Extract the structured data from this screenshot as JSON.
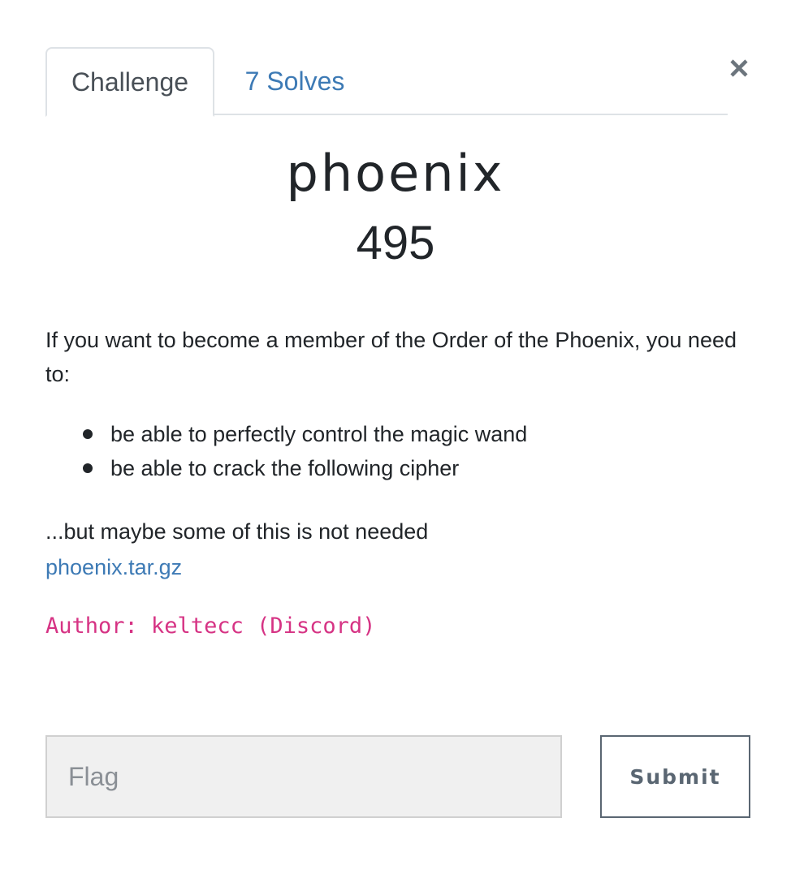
{
  "tabs": [
    {
      "label": "Challenge",
      "active": true
    },
    {
      "label": "7 Solves",
      "active": false
    }
  ],
  "close_icon": "close-icon",
  "challenge": {
    "name": "phoenix",
    "points": "495",
    "description": "If you want to become a member of the Order of the Phoenix, you need to:",
    "requirements": [
      "be able to perfectly control the magic wand",
      "be able to crack the following cipher"
    ],
    "note": "...but maybe some of this is not needed",
    "file_link": "phoenix.tar.gz",
    "author": "Author: keltecc (Discord)"
  },
  "form": {
    "flag_placeholder": "Flag",
    "flag_value": "",
    "submit_label": "Submit"
  },
  "colors": {
    "link": "#3d7ab5",
    "author": "#d63384",
    "text": "#212529"
  }
}
